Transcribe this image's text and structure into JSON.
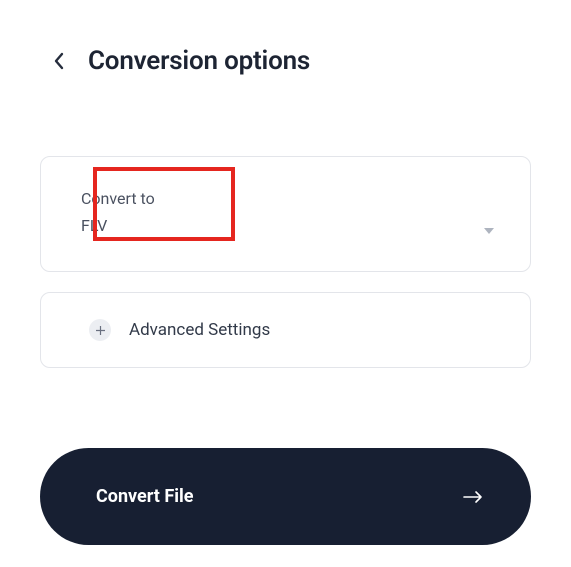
{
  "header": {
    "title": "Conversion options"
  },
  "convert": {
    "label": "Convert to",
    "value": "FLV"
  },
  "advanced": {
    "label": "Advanced Settings"
  },
  "action": {
    "label": "Convert File"
  }
}
